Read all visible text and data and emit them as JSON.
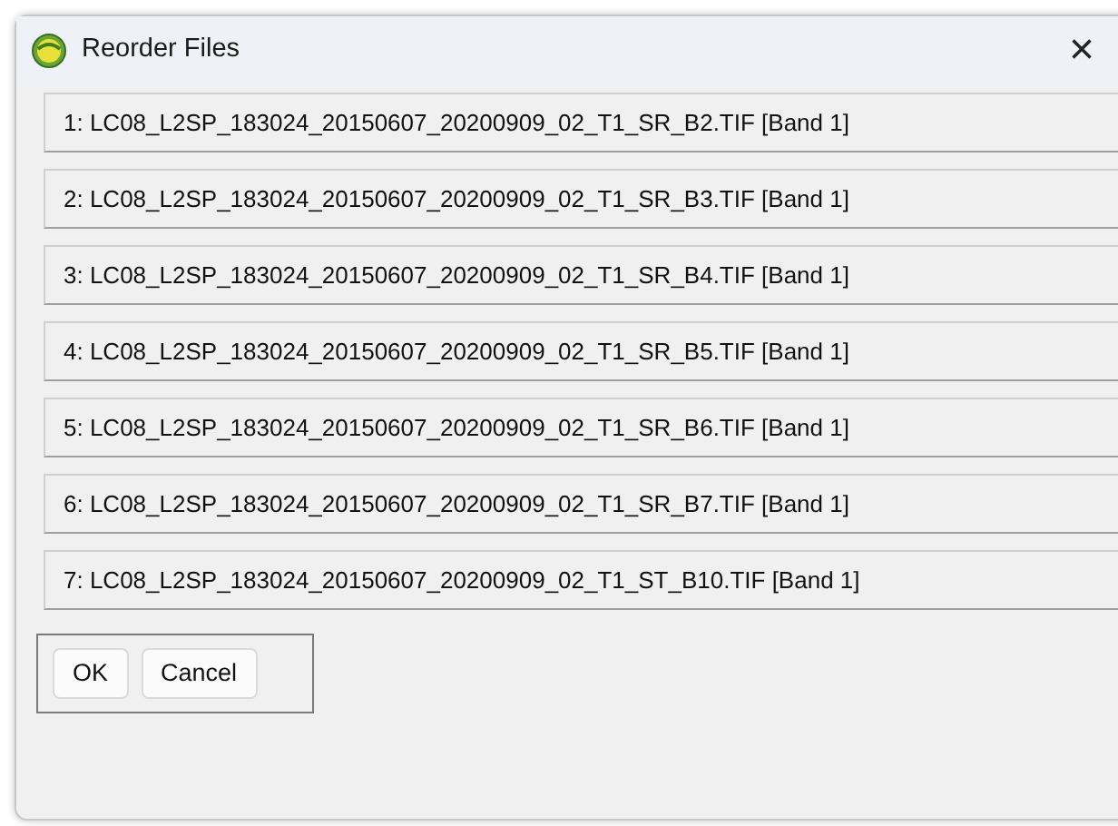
{
  "window": {
    "title": "Reorder Files",
    "close": "×"
  },
  "files": [
    {
      "label": "1: LC08_L2SP_183024_20150607_20200909_02_T1_SR_B2.TIF [Band 1]"
    },
    {
      "label": "2: LC08_L2SP_183024_20150607_20200909_02_T1_SR_B3.TIF [Band 1]"
    },
    {
      "label": "3: LC08_L2SP_183024_20150607_20200909_02_T1_SR_B4.TIF [Band 1]"
    },
    {
      "label": "4: LC08_L2SP_183024_20150607_20200909_02_T1_SR_B5.TIF [Band 1]"
    },
    {
      "label": "5: LC08_L2SP_183024_20150607_20200909_02_T1_SR_B6.TIF [Band 1]"
    },
    {
      "label": "6: LC08_L2SP_183024_20150607_20200909_02_T1_SR_B7.TIF [Band 1]"
    },
    {
      "label": "7: LC08_L2SP_183024_20150607_20200909_02_T1_ST_B10.TIF [Band 1]"
    }
  ],
  "buttons": [
    "OK",
    "Cancel"
  ]
}
